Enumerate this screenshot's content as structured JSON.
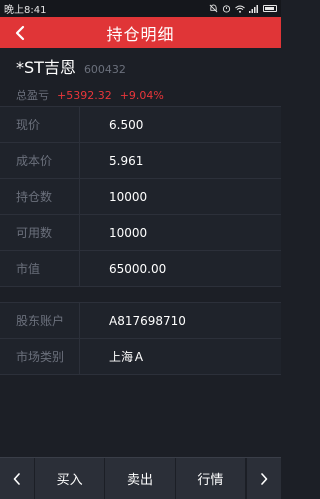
{
  "status": {
    "time": "晚上8:41"
  },
  "nav": {
    "title": "持仓明细"
  },
  "stock": {
    "name": "*ST吉恩",
    "code": "600432",
    "pl_label": "总盈亏",
    "pl_amount": "+5392.32",
    "pl_percent": "+9.04%"
  },
  "details": [
    {
      "label": "现价",
      "value": "6.500"
    },
    {
      "label": "成本价",
      "value": "5.961"
    },
    {
      "label": "持仓数",
      "value": "10000"
    },
    {
      "label": "可用数",
      "value": "10000"
    },
    {
      "label": "市值",
      "value": "65000.00"
    }
  ],
  "account": [
    {
      "label": "股东账户",
      "value": "A817698710"
    },
    {
      "label": "市场类别",
      "value": "上海Ａ"
    }
  ],
  "bottom": {
    "buy": "买入",
    "sell": "卖出",
    "quote": "行情"
  },
  "colors": {
    "accent": "#e03537",
    "profit": "#e8363a",
    "background": "#1c1f26"
  }
}
